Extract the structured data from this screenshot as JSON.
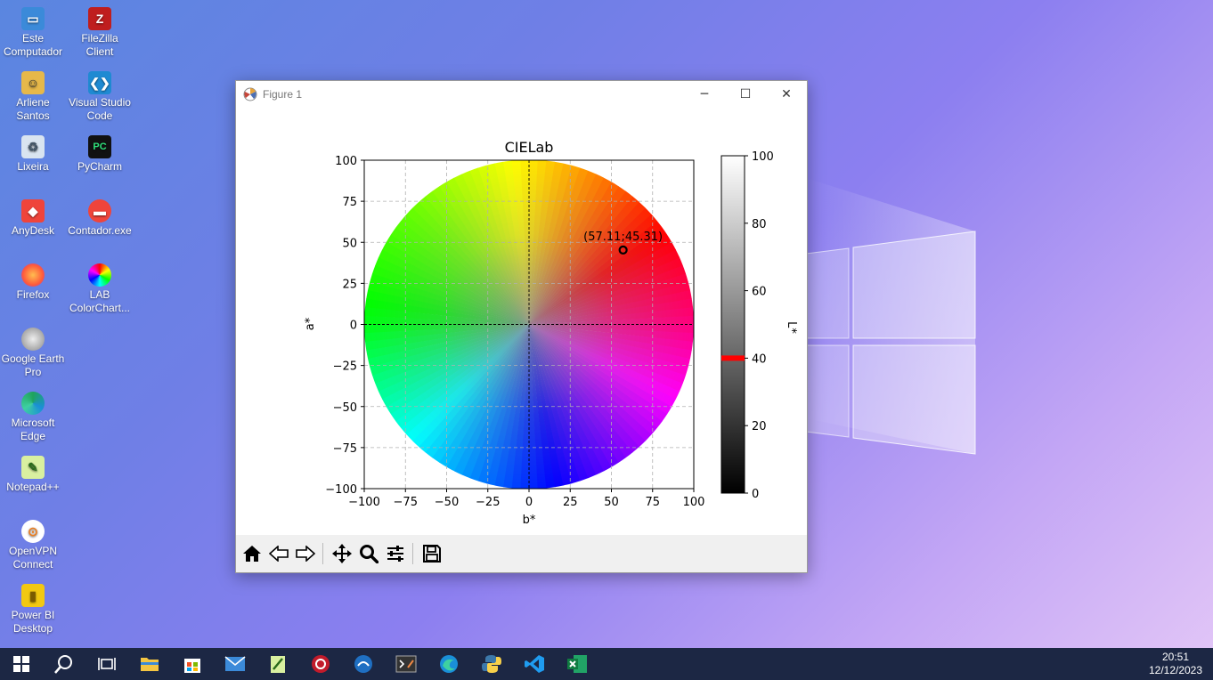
{
  "desktop": {
    "icons": [
      {
        "label": "Este Computador"
      },
      {
        "label": "FileZilla Client"
      },
      {
        "label": "Arliene Santos"
      },
      {
        "label": "Visual Studio Code"
      },
      {
        "label": "Lixeira"
      },
      {
        "label": "PyCharm"
      },
      {
        "label": "AnyDesk"
      },
      {
        "label": "Contador.exe"
      },
      {
        "label": "Firefox"
      },
      {
        "label": "LAB ColorChart..."
      },
      {
        "label": "Google Earth Pro"
      },
      {
        "label": "Microsoft Edge"
      },
      {
        "label": "Notepad++"
      },
      {
        "label": "OpenVPN Connect"
      },
      {
        "label": "Power BI Desktop"
      }
    ]
  },
  "window": {
    "title": "Figure 1",
    "minimize": "─",
    "maximize": "☐",
    "close": "✕"
  },
  "chart_data": {
    "type": "scatter",
    "title": "CIELab",
    "xlabel": "b*",
    "ylabel": "a*",
    "xlim": [
      -100,
      100
    ],
    "ylim": [
      -100,
      100
    ],
    "xticks": [
      "−100",
      "−75",
      "−50",
      "−25",
      "0",
      "25",
      "50",
      "75",
      "100"
    ],
    "yticks": [
      "−100",
      "−75",
      "−50",
      "−25",
      "0",
      "25",
      "50",
      "75",
      "100"
    ],
    "grid": true,
    "points": [
      {
        "x": 57.11,
        "y": 45.31,
        "label": "(57.11;45.31)"
      }
    ],
    "colorbar": {
      "label": "L*",
      "range": [
        0,
        100
      ],
      "ticks": [
        "0",
        "20",
        "40",
        "60",
        "80",
        "100"
      ],
      "marker": 40,
      "marker_color": "#ff0000"
    }
  },
  "toolbar": {
    "buttons": [
      "home",
      "back",
      "forward",
      "pan",
      "zoom",
      "configure-subplots",
      "save"
    ]
  },
  "taskbar": {
    "time": "20:51",
    "date": "12/12/2023"
  }
}
